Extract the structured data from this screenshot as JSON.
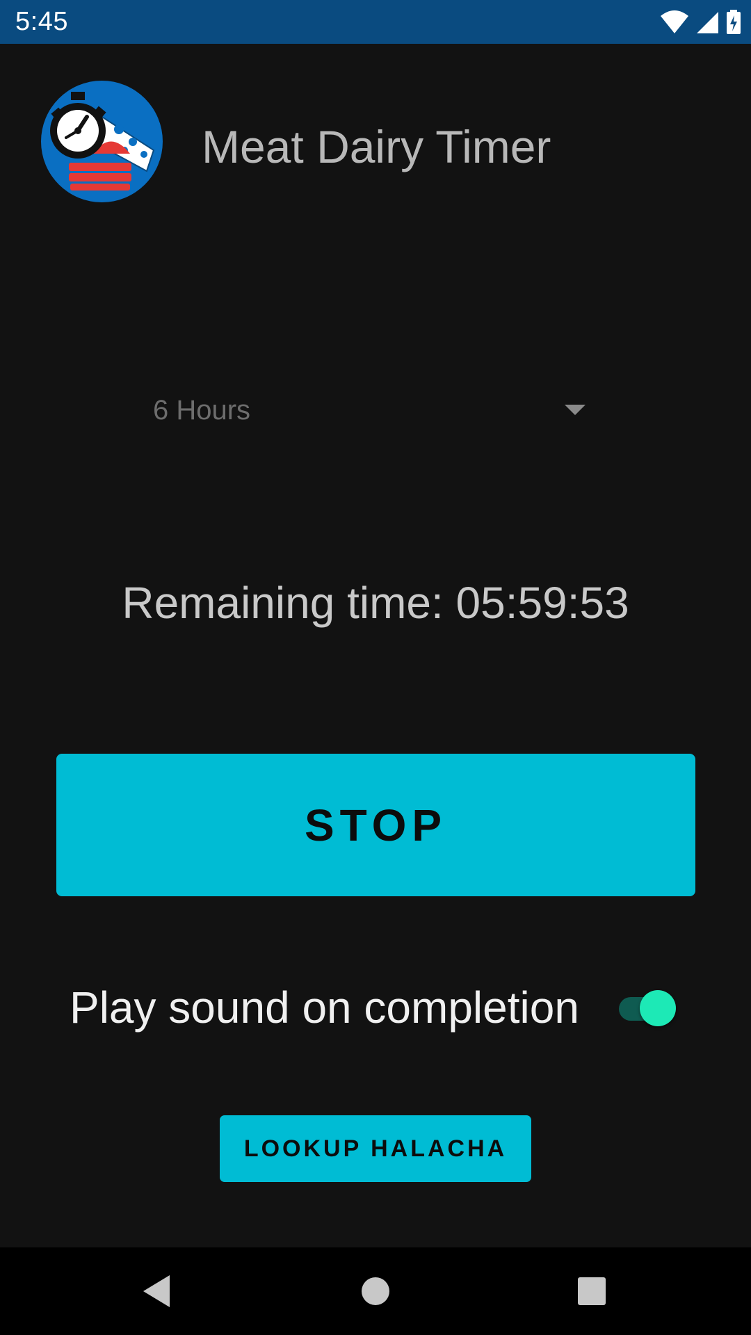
{
  "status_bar": {
    "time": "5:45",
    "icons": [
      "wifi-icon",
      "cell-signal-icon",
      "battery-charging-icon"
    ]
  },
  "header": {
    "app_title": "Meat Dairy Timer",
    "logo_icon": "meat-dairy-timer-logo"
  },
  "duration_spinner": {
    "selected": "6 Hours"
  },
  "remaining": {
    "label": "Remaining time:",
    "value": "05:59:53"
  },
  "stop_button": {
    "label": "STOP"
  },
  "sound_setting": {
    "label": "Play sound on completion",
    "enabled": true
  },
  "lookup_button": {
    "label": "LOOKUP HALACHA"
  },
  "nav_bar": {
    "icons": [
      "back-icon",
      "home-icon",
      "recents-icon"
    ]
  },
  "colors": {
    "status_bar": "#0a4b80",
    "background": "#121212",
    "accent": "#00bcd4",
    "toggle_thumb": "#1de9b6"
  }
}
